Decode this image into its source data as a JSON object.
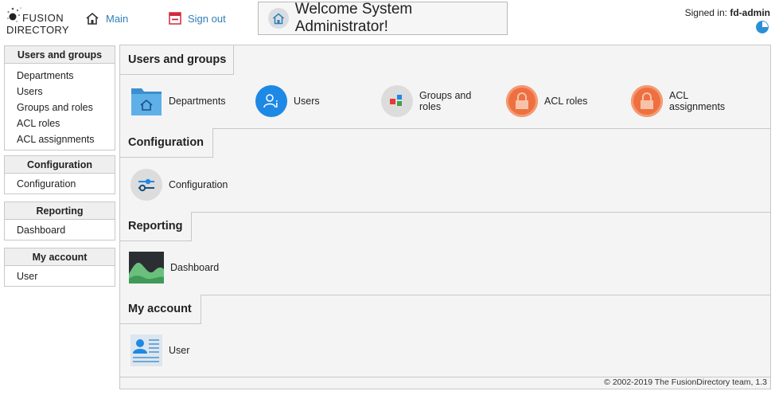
{
  "header": {
    "logo_line1": "FUSION",
    "logo_line2": "DIRECTORY",
    "main_link": "Main",
    "signout_link": "Sign out",
    "welcome": "Welcome System Administrator!",
    "signed_in_label": "Signed in:",
    "signed_in_user": "fd-admin"
  },
  "sidebar": {
    "groups": [
      {
        "title": "Users and groups",
        "items": [
          "Departments",
          "Users",
          "Groups and roles",
          "ACL roles",
          "ACL assignments"
        ]
      },
      {
        "title": "Configuration",
        "items": [
          "Configuration"
        ]
      },
      {
        "title": "Reporting",
        "items": [
          "Dashboard"
        ]
      },
      {
        "title": "My account",
        "items": [
          "User"
        ]
      }
    ]
  },
  "main": {
    "sections": [
      {
        "title": "Users and groups",
        "tiles": [
          {
            "label": "Departments",
            "icon": "folder-home-icon"
          },
          {
            "label": "Users",
            "icon": "user-icon"
          },
          {
            "label": "Groups and roles",
            "icon": "groups-icon"
          },
          {
            "label": "ACL roles",
            "icon": "lock-icon"
          },
          {
            "label": "ACL assignments",
            "icon": "lock-icon"
          }
        ]
      },
      {
        "title": "Configuration",
        "tiles": [
          {
            "label": "Configuration",
            "icon": "sliders-icon"
          }
        ]
      },
      {
        "title": "Reporting",
        "tiles": [
          {
            "label": "Dashboard",
            "icon": "area-chart-icon"
          }
        ]
      },
      {
        "title": "My account",
        "tiles": [
          {
            "label": "User",
            "icon": "id-card-icon"
          }
        ]
      }
    ],
    "footer": "© 2002-2019 The FusionDirectory team, 1.3"
  },
  "colors": {
    "link": "#2f7fb8",
    "user_blue": "#1e88e5",
    "acl_orange": "#ee7040",
    "signout_red": "#d2283c"
  }
}
